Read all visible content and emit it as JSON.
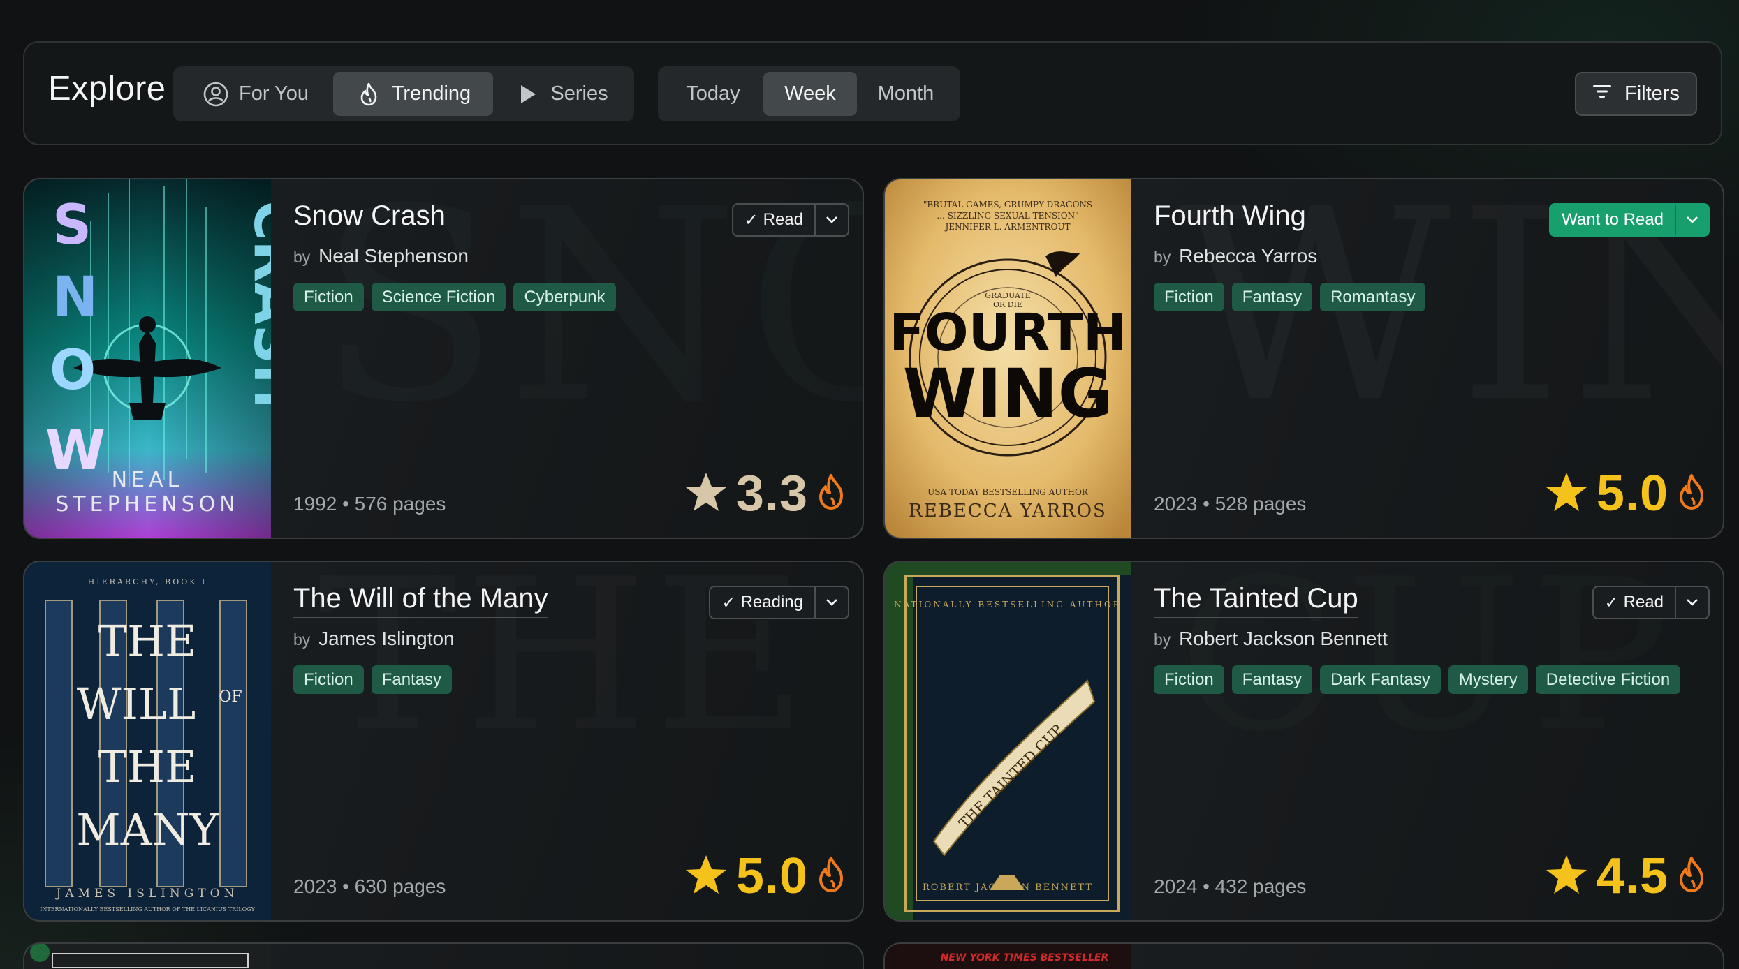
{
  "header": {
    "title": "Explore",
    "nav_tabs": [
      {
        "label": "For You",
        "icon": "user-circle-icon",
        "active": false
      },
      {
        "label": "Trending",
        "icon": "flame-icon",
        "active": true
      },
      {
        "label": "Series",
        "icon": "play-icon",
        "active": false
      }
    ],
    "period_tabs": [
      {
        "label": "Today",
        "active": false
      },
      {
        "label": "Week",
        "active": true
      },
      {
        "label": "Month",
        "active": false
      }
    ],
    "filters_label": "Filters"
  },
  "by_label": "by",
  "colors": {
    "accent_green": "#17a06d",
    "tag_bg": "#1f5a47",
    "star_gold": "#f4c21a",
    "flame_orange": "#f07a1a"
  },
  "books": [
    {
      "title": "Snow Crash",
      "author": "Neal Stephenson",
      "tags": [
        "Fiction",
        "Science Fiction",
        "Cyberpunk"
      ],
      "year": "1992",
      "pages": "576 pages",
      "meta": "1992 • 576 pages",
      "rating": "3.3",
      "status": "Read",
      "status_mark": "✓",
      "cover_title": "SNOW CRASH",
      "cover_top_left": "SNOW",
      "cover_top_right": "CRASH",
      "cover_author": "NEAL STEPHENSON"
    },
    {
      "title": "Fourth Wing",
      "author": "Rebecca Yarros",
      "tags": [
        "Fiction",
        "Fantasy",
        "Romantasy"
      ],
      "year": "2023",
      "pages": "528 pages",
      "meta": "2023 • 528 pages",
      "rating": "5.0",
      "status": "Want to Read",
      "status_mark": "",
      "cover_blurb_1": "\"BRUTAL GAMES, GRUMPY DRAGONS",
      "cover_blurb_2": "... SIZZLING SEXUAL TENSION\"",
      "cover_blurb_3": "JENNIFER L. ARMENTROUT",
      "cover_title_1": "FOURTH",
      "cover_title_2": "WING",
      "cover_tagline_1": "GRADUATE",
      "cover_tagline_2": "OR DIE",
      "cover_byline": "USA TODAY BESTSELLING AUTHOR",
      "cover_author": "REBECCA YARROS"
    },
    {
      "title": "The Will of the Many",
      "author": "James Islington",
      "tags": [
        "Fiction",
        "Fantasy"
      ],
      "year": "2023",
      "pages": "630 pages",
      "meta": "2023 • 630 pages",
      "rating": "5.0",
      "status": "Reading",
      "status_mark": "✓",
      "cover_series": "HIERARCHY, BOOK I",
      "cover_title_1": "THE",
      "cover_title_2": "WILL",
      "cover_title_of": "OF",
      "cover_title_3": "THE",
      "cover_title_4": "MANY",
      "cover_author": "JAMES ISLINGTON",
      "cover_byline": "INTERNATIONALLY BESTSELLING AUTHOR OF THE LICANIUS TRILOGY"
    },
    {
      "title": "The Tainted Cup",
      "author": "Robert Jackson Bennett",
      "tags": [
        "Fiction",
        "Fantasy",
        "Dark Fantasy",
        "Mystery",
        "Detective Fiction"
      ],
      "year": "2024",
      "pages": "432 pages",
      "meta": "2024 • 432 pages",
      "rating": "4.5",
      "status": "Read",
      "status_mark": "✓",
      "cover_top": "NATIONALLY BESTSELLING AUTHOR",
      "cover_title": "THE TAINTED CUP",
      "cover_author": "ROBERT JACKSON BENNETT"
    }
  ],
  "partial_row": {
    "right_cover_banner": "NEW YORK TIMES BESTSELLER"
  }
}
